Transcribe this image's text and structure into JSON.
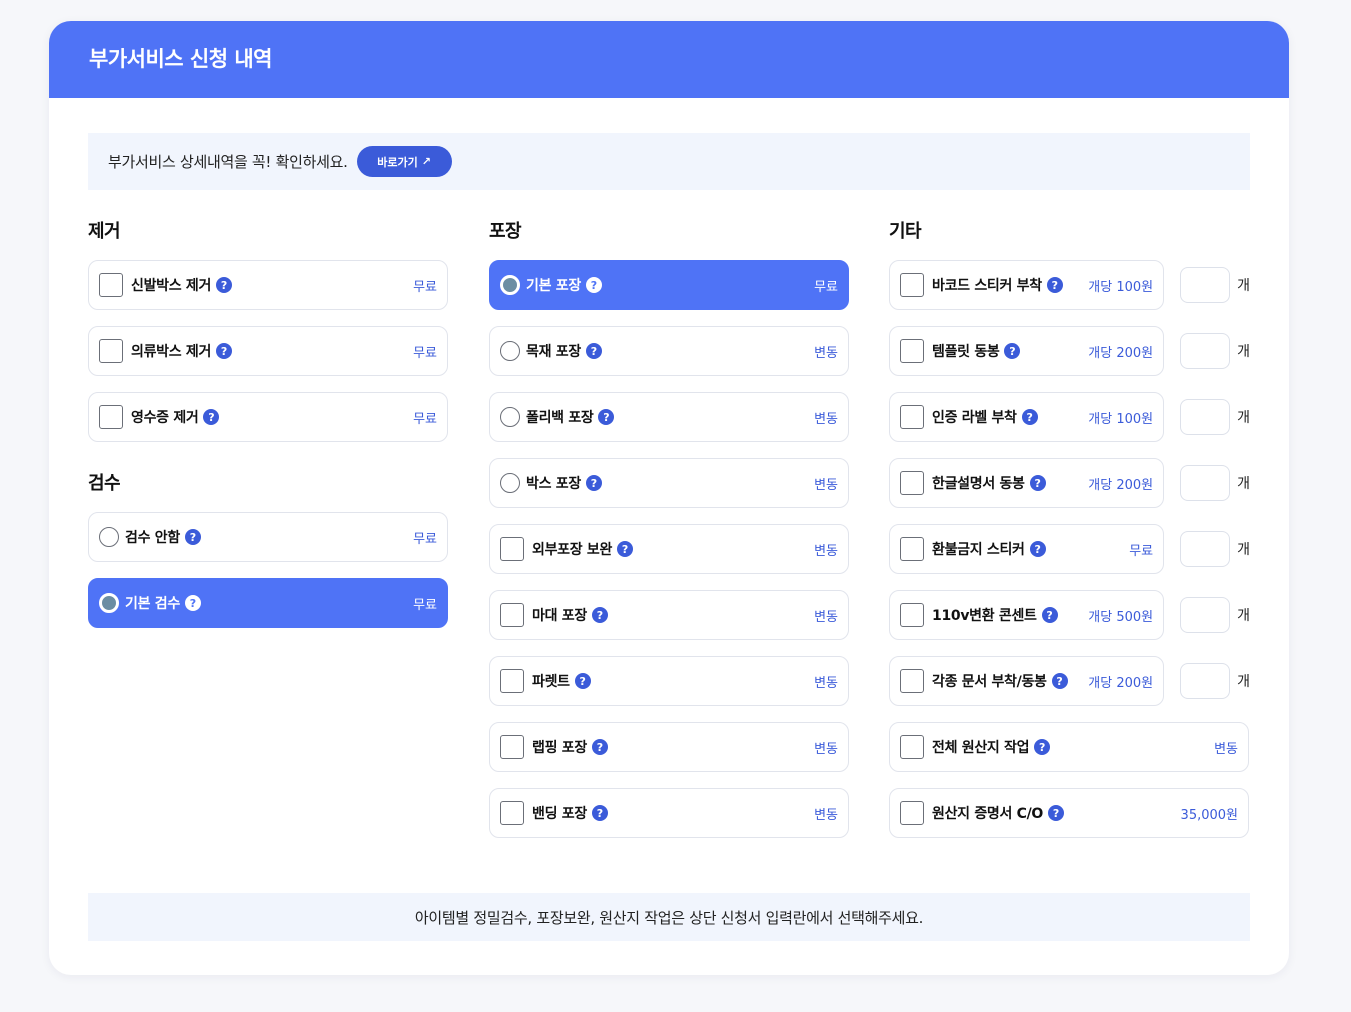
{
  "header": {
    "title": "부가서비스 신청 내역"
  },
  "notice": {
    "text": "부가서비스 상세내역을 꼭! 확인하세요.",
    "button_label": "바로가기",
    "button_icon": "↗"
  },
  "removal": {
    "title": "제거",
    "items": [
      {
        "label": "신발박스 제거",
        "price": "무료"
      },
      {
        "label": "의류박스 제거",
        "price": "무료"
      },
      {
        "label": "영수증 제거",
        "price": "무료"
      }
    ]
  },
  "inspection": {
    "title": "검수",
    "items": [
      {
        "label": "검수 안함",
        "price": "무료"
      },
      {
        "label": "기본 검수",
        "price": "무료"
      }
    ]
  },
  "packaging": {
    "title": "포장",
    "items": [
      {
        "label": "기본 포장",
        "price": "무료"
      },
      {
        "label": "목재 포장",
        "price": "변동"
      },
      {
        "label": "폴리백 포장",
        "price": "변동"
      },
      {
        "label": "박스 포장",
        "price": "변동"
      },
      {
        "label": "외부포장 보완",
        "price": "변동"
      },
      {
        "label": "마대 포장",
        "price": "변동"
      },
      {
        "label": "파렛트",
        "price": "변동"
      },
      {
        "label": "랩핑 포장",
        "price": "변동"
      },
      {
        "label": "밴딩 포장",
        "price": "변동"
      }
    ]
  },
  "etc": {
    "title": "기타",
    "unit": "개",
    "items": [
      {
        "label": "바코드 스티커 부착",
        "price": "개당 100원"
      },
      {
        "label": "템플릿 동봉",
        "price": "개당 200원"
      },
      {
        "label": "인증 라벨 부착",
        "price": "개당 100원"
      },
      {
        "label": "한글설명서 동봉",
        "price": "개당 200원"
      },
      {
        "label": "환불금지 스티커",
        "price": "무료"
      },
      {
        "label": "110v변환 콘센트",
        "price": "개당 500원"
      },
      {
        "label": "각종 문서 부착/동봉",
        "price": "개당 200원"
      },
      {
        "label": "전체 원산지 작업",
        "price": "변동"
      },
      {
        "label": "원산지 증명서 C/O",
        "price": "35,000원"
      }
    ]
  },
  "help_glyph": "?",
  "footer": {
    "note": "아이템별 정밀검수, 포장보완, 원산지 작업은 상단 신청서 입력란에서 선택해주세요."
  },
  "colors": {
    "accent": "#4f73f6",
    "accent_dark": "#3b5bd9",
    "panel_bg": "#f1f5fd"
  }
}
